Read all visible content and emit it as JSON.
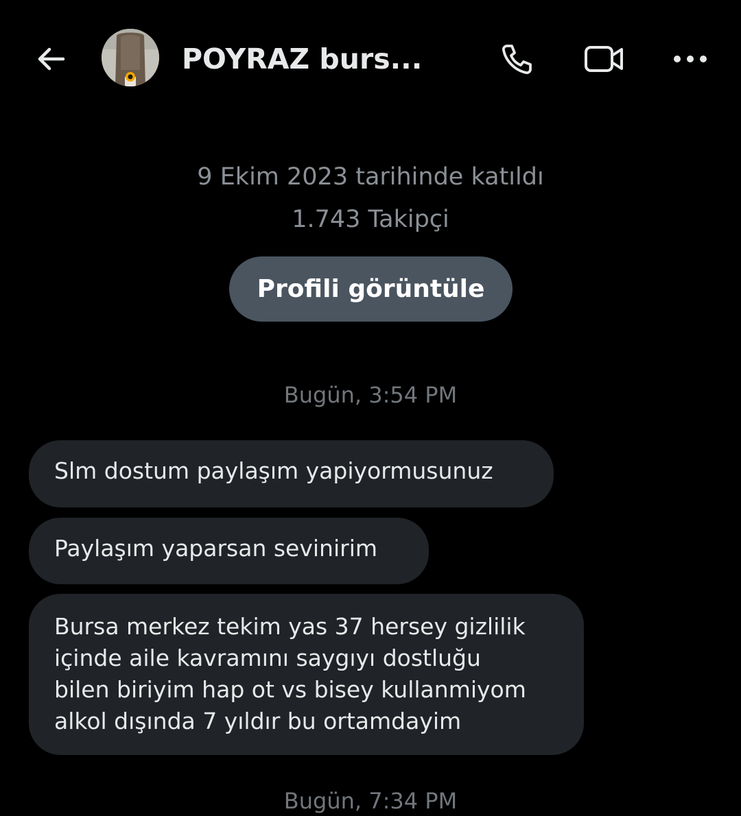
{
  "header": {
    "title": "POYRAZ burs...",
    "back_icon": "arrow-left-icon",
    "call_icon": "phone-icon",
    "video_icon": "video-camera-icon",
    "more_icon": "more-horizontal-icon"
  },
  "profile": {
    "joined": "9 Ekim 2023 tarihinde katıldı",
    "followers": "1.743 Takipçi",
    "view_profile_label": "Profili görüntüle"
  },
  "conversation": {
    "separators": [
      "Bugün, 3:54 PM",
      "Bugün, 7:34 PM"
    ],
    "messages": [
      {
        "lines": [
          "Slm dostum paylaşım yapiyormusunuz"
        ]
      },
      {
        "lines": [
          "Paylaşım yaparsan sevinirim"
        ]
      },
      {
        "lines": [
          "Bursa merkez tekim yas 37 hersey gizlilik",
          "içinde aile kavramını saygıyı dostluğu",
          "bilen biriyim hap ot vs bisey kullanmiyom",
          "alkol dışında 7 yıldır bu ortamdayim"
        ]
      }
    ]
  },
  "colors": {
    "background": "#000000",
    "primary_text": "#e7e9ea",
    "secondary_text": "#71767b",
    "bubble": "#202327",
    "button": "#4a5560"
  }
}
